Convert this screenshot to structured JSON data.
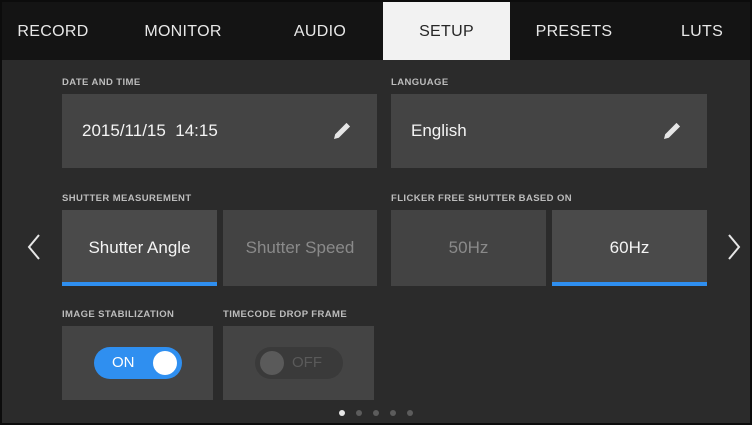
{
  "tabs": [
    {
      "label": "RECORD",
      "active": false
    },
    {
      "label": "MONITOR",
      "active": false
    },
    {
      "label": "AUDIO",
      "active": false
    },
    {
      "label": "SETUP",
      "active": true
    },
    {
      "label": "PRESETS",
      "active": false
    },
    {
      "label": "LUTS",
      "active": false
    }
  ],
  "date_time": {
    "label": "DATE AND TIME",
    "value": "2015/11/15  14:15",
    "icon": "pencil-icon"
  },
  "language": {
    "label": "LANGUAGE",
    "value": "English",
    "icon": "pencil-icon"
  },
  "shutter_measurement": {
    "label": "SHUTTER MEASUREMENT",
    "options": [
      "Shutter Angle",
      "Shutter Speed"
    ],
    "selected": "Shutter Angle"
  },
  "flicker_free": {
    "label": "FLICKER FREE SHUTTER BASED ON",
    "options": [
      "50Hz",
      "60Hz"
    ],
    "selected": "60Hz"
  },
  "image_stabilization": {
    "label": "IMAGE STABILIZATION",
    "state": "ON",
    "enabled": true
  },
  "timecode_drop_frame": {
    "label": "TIMECODE DROP FRAME",
    "state": "OFF",
    "enabled": false
  },
  "pagination": {
    "pages": 5,
    "current": 1
  },
  "colors": {
    "accent": "#2f8ff0",
    "tab_active_bg": "#f2f2f2",
    "tab_bar_bg": "#141414",
    "panel_bg": "#2b2b2b",
    "box_bg": "#444444"
  }
}
